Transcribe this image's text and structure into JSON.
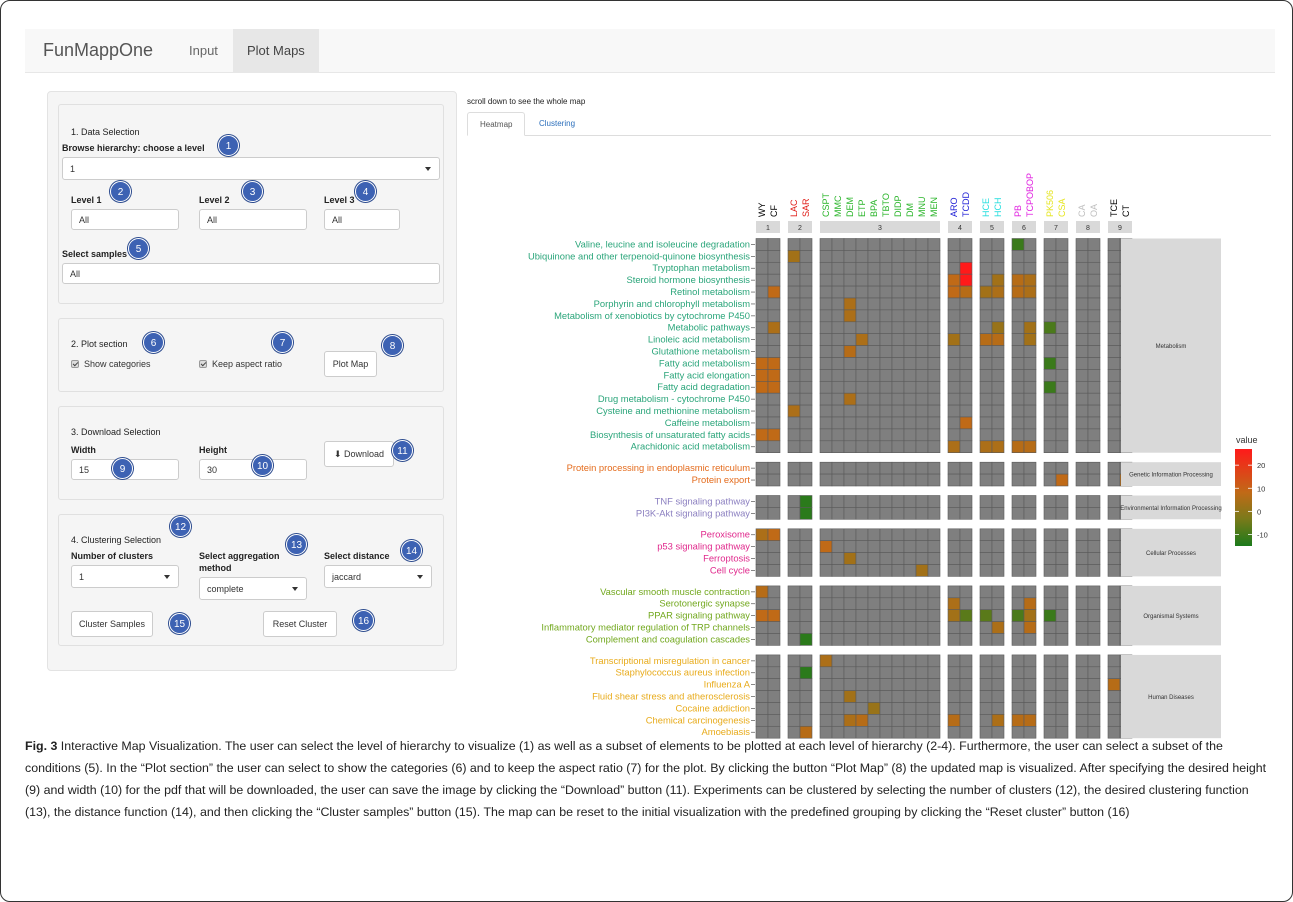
{
  "navbar": {
    "brand": "FunMappOne",
    "tabs": [
      {
        "label": "Input",
        "active": false
      },
      {
        "label": "Plot Maps",
        "active": true
      }
    ]
  },
  "sidebar": {
    "data_selection": {
      "title": "1. Data Selection",
      "hierarchy_label": "Browse hierarchy: choose a level",
      "hierarchy_value": "1",
      "level1_label": "Level 1",
      "level1_value": "All",
      "level2_label": "Level 2",
      "level2_value": "All",
      "level3_label": "Level 3",
      "level3_value": "All",
      "samples_label": "Select samples",
      "samples_value": "All"
    },
    "plot_section": {
      "title": "2. Plot section",
      "show_categories": "Show categories",
      "keep_aspect": "Keep aspect ratio",
      "plot_button": "Plot Map"
    },
    "download": {
      "title": "3. Download Selection",
      "width_label": "Width",
      "width_value": "15",
      "height_label": "Height",
      "height_value": "30",
      "button": "Download"
    },
    "clustering": {
      "title": "4. Clustering Selection",
      "nclusters_label": "Number of clusters",
      "nclusters_value": "1",
      "aggregation_label_1": "Select aggregation",
      "aggregation_label_2": "method",
      "aggregation_value": "complete",
      "distance_label": "Select distance",
      "distance_value": "jaccard",
      "cluster_button": "Cluster Samples",
      "reset_button": "Reset Cluster"
    },
    "badges": [
      "1",
      "2",
      "3",
      "4",
      "5",
      "6",
      "7",
      "8",
      "9",
      "10",
      "11",
      "12",
      "13",
      "14",
      "15",
      "16"
    ]
  },
  "main": {
    "scroll_note": "scroll down to see the whole map",
    "tabs": [
      {
        "label": "Heatmap",
        "active": true
      },
      {
        "label": "Clustering",
        "active": false
      }
    ]
  },
  "colors": {
    "high": "#ff1a1a",
    "mid_high": "#c06a17",
    "zero": "#7a7a1a",
    "low": "#1b7a1b",
    "empty": "#7f7f7f",
    "strip": "#d9d9d9"
  },
  "chart_data": {
    "type": "heatmap",
    "legend_title": "value",
    "legend_ticks": [
      20,
      10,
      0,
      -10
    ],
    "value_range": [
      -15,
      27
    ],
    "column_groups": [
      {
        "label": "1",
        "columns": [
          {
            "name": "WY",
            "color": "#000000"
          },
          {
            "name": "CF",
            "color": "#000000"
          }
        ]
      },
      {
        "label": "2",
        "columns": [
          {
            "name": "LAC",
            "color": "#e0201b"
          },
          {
            "name": "SAR",
            "color": "#e0201b"
          }
        ]
      },
      {
        "label": "3",
        "columns": [
          {
            "name": "CSPT",
            "color": "#2ab52a"
          },
          {
            "name": "MMC",
            "color": "#2ab52a"
          },
          {
            "name": "DEM",
            "color": "#2ab52a"
          },
          {
            "name": "ETP",
            "color": "#2ab52a"
          },
          {
            "name": "BPA",
            "color": "#2ab52a"
          },
          {
            "name": "TBTO",
            "color": "#2ab52a"
          },
          {
            "name": "DIDP",
            "color": "#2ab52a"
          },
          {
            "name": "DM",
            "color": "#2ab52a"
          },
          {
            "name": "MNU",
            "color": "#2ab52a"
          },
          {
            "name": "MEN",
            "color": "#2ab52a"
          }
        ]
      },
      {
        "label": "4",
        "columns": [
          {
            "name": "ARO",
            "color": "#2323d6"
          },
          {
            "name": "TCDD",
            "color": "#2323d6"
          }
        ]
      },
      {
        "label": "5",
        "columns": [
          {
            "name": "HCE",
            "color": "#28dede"
          },
          {
            "name": "HCH",
            "color": "#28dede"
          }
        ]
      },
      {
        "label": "6",
        "columns": [
          {
            "name": "PB",
            "color": "#e020e0"
          },
          {
            "name": "TCPOBOP",
            "color": "#e020e0"
          }
        ]
      },
      {
        "label": "7",
        "columns": [
          {
            "name": "PK506",
            "color": "#e6e621"
          },
          {
            "name": "CSA",
            "color": "#e6e621"
          }
        ]
      },
      {
        "label": "8",
        "columns": [
          {
            "name": "CA",
            "color": "#bfbfbf"
          },
          {
            "name": "OA",
            "color": "#bfbfbf"
          }
        ]
      },
      {
        "label": "9",
        "columns": [
          {
            "name": "TCE",
            "color": "#000000"
          },
          {
            "name": "CT",
            "color": "#000000"
          }
        ]
      }
    ],
    "row_groups": [
      {
        "category": "Metabolism",
        "color": "#2aa57a",
        "rows": [
          {
            "name": "Valine, leucine and isoleucine degradation",
            "cells": {
              "18": -8
            }
          },
          {
            "name": "Ubiquinone and other terpenoid-quinone biosynthesis",
            "cells": {
              "2": 8
            }
          },
          {
            "name": "Tryptophan metabolism",
            "cells": {
              "15": 27
            }
          },
          {
            "name": "Steroid hormone biosynthesis",
            "cells": {
              "14": 14,
              "15": 27,
              "17": 8,
              "18": 12,
              "19": 10
            }
          },
          {
            "name": "Retinol metabolism",
            "cells": {
              "1": 14,
              "14": 14,
              "15": 12,
              "16": 8,
              "17": 10,
              "18": 12,
              "19": 10
            }
          },
          {
            "name": "Porphyrin and chlorophyll metabolism",
            "cells": {
              "6": 10
            }
          },
          {
            "name": "Metabolism of xenobiotics by cytochrome P450",
            "cells": {
              "6": 10
            }
          },
          {
            "name": "Metabolic pathways",
            "cells": {
              "1": 10,
              "17": 6,
              "19": 8,
              "20": -6
            }
          },
          {
            "name": "Linoleic acid metabolism",
            "cells": {
              "7": 10,
              "14": 8,
              "16": 12,
              "17": 12,
              "19": 8
            }
          },
          {
            "name": "Glutathione metabolism",
            "cells": {
              "6": 12
            }
          },
          {
            "name": "Fatty acid metabolism",
            "cells": {
              "0": 14,
              "1": 14,
              "20": -8
            }
          },
          {
            "name": "Fatty acid elongation",
            "cells": {
              "0": 14,
              "1": 14
            }
          },
          {
            "name": "Fatty acid degradation",
            "cells": {
              "0": 14,
              "1": 14,
              "20": -8
            }
          },
          {
            "name": "Drug metabolism - cytochrome P450",
            "cells": {
              "6": 10
            }
          },
          {
            "name": "Cysteine and methionine metabolism",
            "cells": {
              "2": 10
            }
          },
          {
            "name": "Caffeine metabolism",
            "cells": {
              "15": 14
            }
          },
          {
            "name": "Biosynthesis of unsaturated fatty acids",
            "cells": {
              "0": 14,
              "1": 14
            }
          },
          {
            "name": "Arachidonic acid metabolism",
            "cells": {
              "14": 10,
              "16": 10,
              "17": 10,
              "18": 12,
              "19": 12
            }
          }
        ]
      },
      {
        "category": "Genetic Information Processing",
        "color": "#e46b1c",
        "rows": [
          {
            "name": "Protein processing in endoplasmic reticulum",
            "cells": {}
          },
          {
            "name": "Protein export",
            "cells": {
              "21": 14,
              "25": 12
            }
          }
        ]
      },
      {
        "category": "Environmental Information Processing",
        "color": "#8b7fc0",
        "rows": [
          {
            "name": "TNF signaling pathway",
            "cells": {
              "3": -10
            }
          },
          {
            "name": "PI3K-Akt signaling pathway",
            "cells": {
              "3": -10
            }
          }
        ]
      },
      {
        "category": "Cellular Processes",
        "color": "#e0288c",
        "rows": [
          {
            "name": "Peroxisome",
            "cells": {
              "0": 10,
              "1": 14
            }
          },
          {
            "name": "p53 signaling pathway",
            "cells": {
              "4": 14
            }
          },
          {
            "name": "Ferroptosis",
            "cells": {
              "6": 8
            }
          },
          {
            "name": "Cell cycle",
            "cells": {
              "12": 8
            }
          }
        ]
      },
      {
        "category": "Organismal Systems",
        "color": "#72a81e",
        "rows": [
          {
            "name": "Vascular smooth muscle contraction",
            "cells": {
              "0": 12
            }
          },
          {
            "name": "Serotonergic synapse",
            "cells": {
              "14": 10,
              "19": 12
            }
          },
          {
            "name": "PPAR signaling pathway",
            "cells": {
              "0": 14,
              "1": 14,
              "14": 8,
              "15": -4,
              "16": -4,
              "18": -6,
              "19": 8,
              "20": -8
            }
          },
          {
            "name": "Inflammatory mediator regulation of TRP channels",
            "cells": {
              "17": 10,
              "19": 12
            }
          },
          {
            "name": "Complement and coagulation cascades",
            "cells": {
              "3": -10
            }
          }
        ]
      },
      {
        "category": "Human Diseases",
        "color": "#e8ab1b",
        "rows": [
          {
            "name": "Transcriptional misregulation in cancer",
            "cells": {
              "4": 10
            }
          },
          {
            "name": "Staphylococcus aureus infection",
            "cells": {
              "3": -10
            }
          },
          {
            "name": "Influenza A",
            "cells": {
              "24": 12
            }
          },
          {
            "name": "Fluid shear stress and atherosclerosis",
            "cells": {
              "6": 8
            }
          },
          {
            "name": "Cocaine addiction",
            "cells": {
              "8": 6
            }
          },
          {
            "name": "Chemical carcinogenesis",
            "cells": {
              "6": 10,
              "7": 12,
              "14": 12,
              "17": 10,
              "18": 12,
              "19": 12
            }
          },
          {
            "name": "Amoebiasis",
            "cells": {
              "3": 12
            }
          }
        ]
      }
    ]
  },
  "caption": {
    "fig": "Fig. 3",
    "text": " Interactive Map Visualization. The user can select the level of hierarchy to visualize (1) as well as a subset of elements to be plotted at each level of hierarchy (2-4). Furthermore, the user can select a subset of the conditions (5). In the “Plot section” the user can select to show the categories (6) and to keep the aspect ratio (7) for the plot. By clicking the button “Plot Map” (8) the updated map is visualized. After specifying the desired height (9) and width (10) for the pdf that will be downloaded, the user can save the image by clicking the “Download” button (11). Experiments can be clustered by selecting the number of clusters (12), the desired clustering function (13), the distance function (14), and then clicking the “Cluster samples” button (15). The map can be reset to the initial visualization with the predefined grouping by clicking the “Reset cluster” button (16)"
  }
}
